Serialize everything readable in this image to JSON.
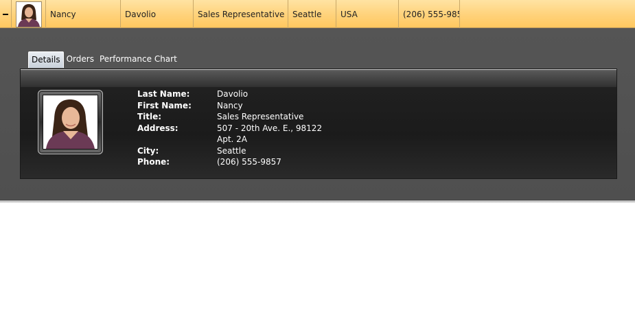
{
  "employee": {
    "first_name": "Nancy",
    "last_name": "Davolio",
    "title": "Sales Representative",
    "city": "Seattle",
    "country": "USA",
    "phone": "(206) 555-9857",
    "address_line1": "507 - 20th Ave. E., 98122",
    "address_line2": "Apt. 2A"
  },
  "tabs": [
    {
      "label": "Details",
      "active": true
    },
    {
      "label": "Orders",
      "active": false
    },
    {
      "label": "Performance Chart",
      "active": false
    }
  ],
  "labels": {
    "last_name": "Last Name:",
    "first_name": "First Name:",
    "title": "Title:",
    "address": "Address:",
    "city": "City:",
    "phone": "Phone:"
  },
  "colors": {
    "row_highlight": "#ffd27a",
    "details_bg": "#535353",
    "panel_bg": "#1f1f1f"
  }
}
